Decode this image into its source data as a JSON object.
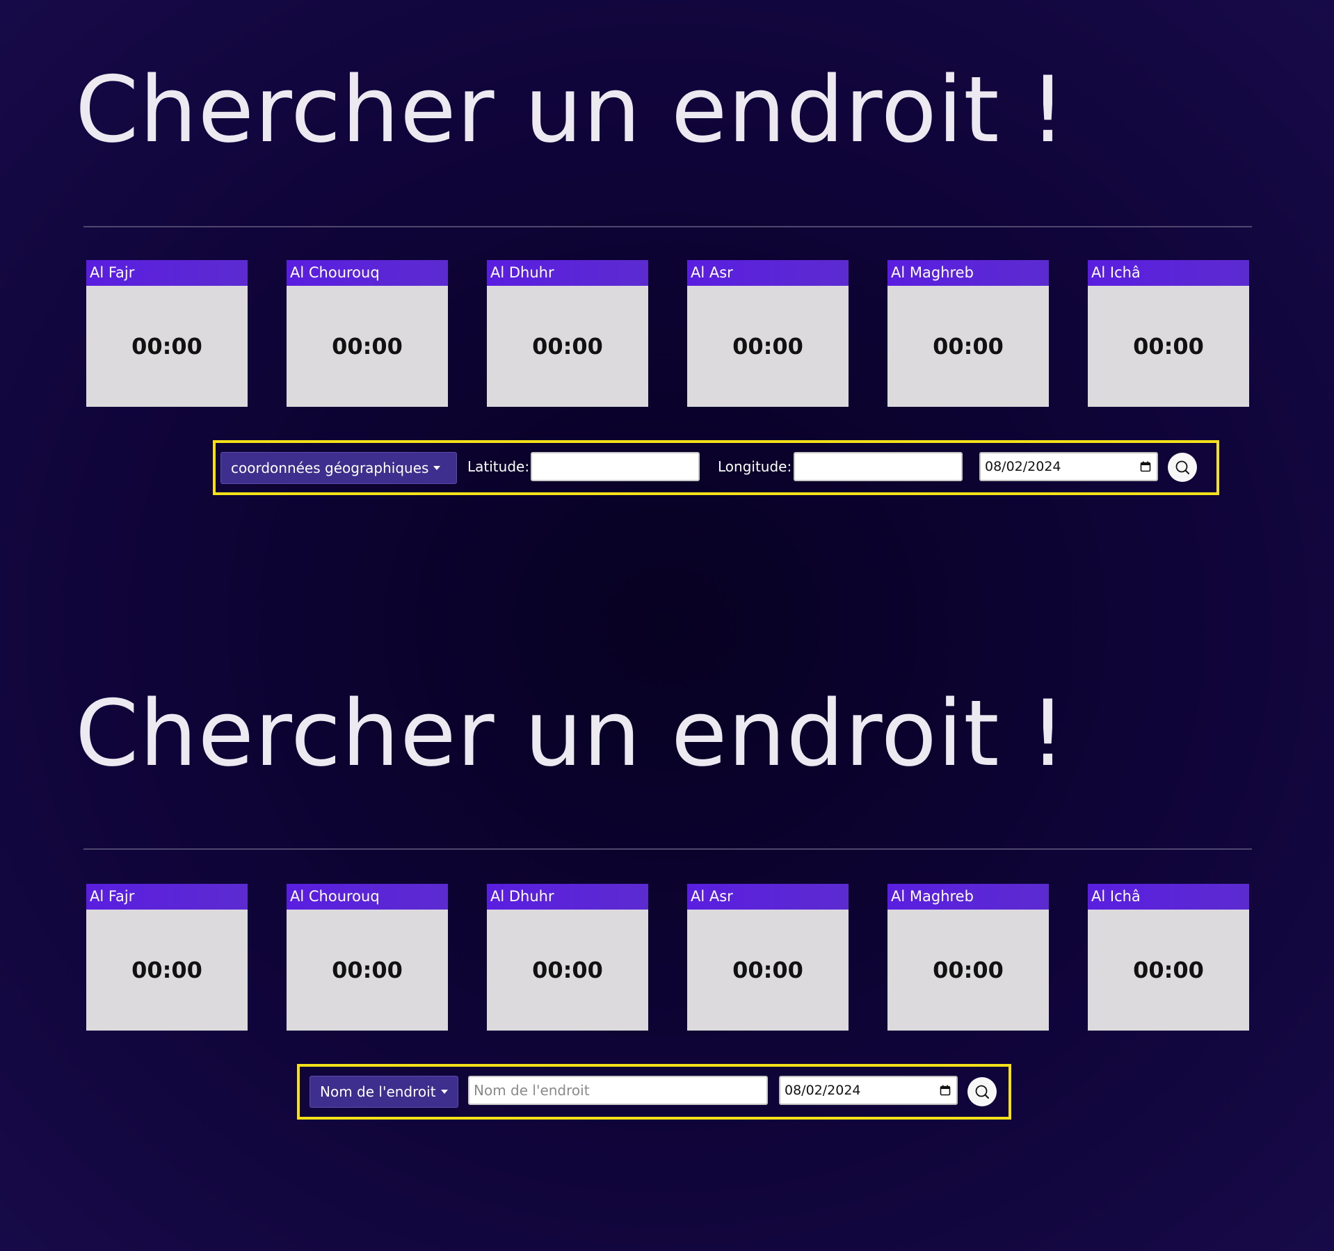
{
  "sections": [
    {
      "title": "Chercher un endroit !",
      "prayers": [
        {
          "name": "Al Fajr",
          "time": "00:00"
        },
        {
          "name": "Al Chourouq",
          "time": "00:00"
        },
        {
          "name": "Al Dhuhr",
          "time": "00:00"
        },
        {
          "name": "Al Asr",
          "time": "00:00"
        },
        {
          "name": "Al Maghreb",
          "time": "00:00"
        },
        {
          "name": "Al Ichâ",
          "time": "00:00"
        }
      ],
      "search": {
        "mode_label": "coordonnées géographiques",
        "latitude_label": "Latitude:",
        "latitude_value": "",
        "longitude_label": "Longitude:",
        "longitude_value": "",
        "date_value": "08/02/2024"
      }
    },
    {
      "title": "Chercher un endroit !",
      "prayers": [
        {
          "name": "Al Fajr",
          "time": "00:00"
        },
        {
          "name": "Al Chourouq",
          "time": "00:00"
        },
        {
          "name": "Al Dhuhr",
          "time": "00:00"
        },
        {
          "name": "Al Asr",
          "time": "00:00"
        },
        {
          "name": "Al Maghreb",
          "time": "00:00"
        },
        {
          "name": "Al Ichâ",
          "time": "00:00"
        }
      ],
      "search": {
        "mode_label": "Nom de l'endroit",
        "place_placeholder": "Nom de l'endroit",
        "place_value": "",
        "date_value": "08/02/2024"
      }
    }
  ],
  "icons": {
    "search": "search-icon",
    "calendar": "calendar-icon",
    "dropdown": "chevron-down-icon"
  },
  "colors": {
    "background": "#0d0330",
    "card_header": "#5a1ee0",
    "card_body": "#dcdadd",
    "dropdown": "#3e2f8f",
    "highlight": "#f5e11a",
    "title": "#ece9f1"
  }
}
